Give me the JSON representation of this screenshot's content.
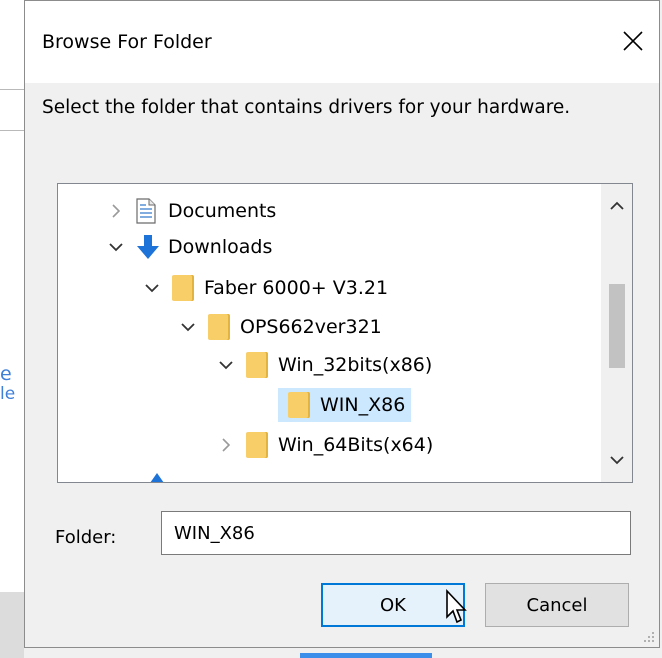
{
  "background": {
    "fragment_top": "e",
    "fragment_bottom": "le"
  },
  "dialog": {
    "title": "Browse For Folder",
    "instruction": "Select the folder that contains drivers for your hardware.",
    "tree": {
      "items": [
        {
          "label": "Documents",
          "icon": "documents-icon",
          "chevron": "collapsed"
        },
        {
          "label": "Downloads",
          "icon": "download-arrow-icon",
          "chevron": "expanded"
        },
        {
          "label": "Faber 6000+ V3.21",
          "icon": "folder-icon",
          "chevron": "expanded"
        },
        {
          "label": "OPS662ver321",
          "icon": "folder-icon",
          "chevron": "expanded"
        },
        {
          "label": "Win_32bits(x86)",
          "icon": "folder-icon",
          "chevron": "expanded"
        },
        {
          "label": "WIN_X86",
          "icon": "folder-icon",
          "chevron": "none",
          "selected": true
        },
        {
          "label": "Win_64Bits(x64)",
          "icon": "folder-icon",
          "chevron": "collapsed"
        }
      ]
    },
    "folder_label": "Folder:",
    "folder_value": "WIN_X86",
    "ok_label": "OK",
    "cancel_label": "Cancel"
  },
  "colors": {
    "accent": "#0078d7",
    "selection": "#cce8ff",
    "folder": "#f7ce68"
  }
}
